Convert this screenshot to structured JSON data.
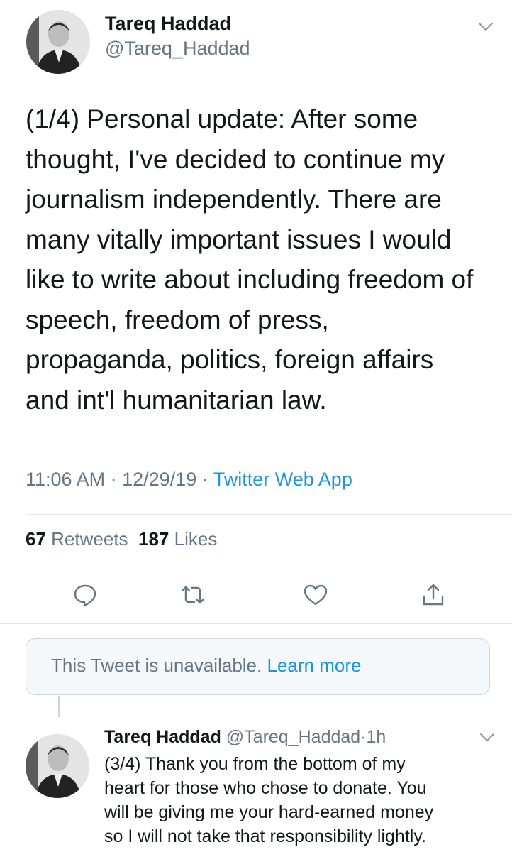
{
  "main_tweet": {
    "author_name": "Tareq Haddad",
    "author_handle": "@Tareq_Haddad",
    "text_lines": [
      "(1/4) Personal update: After some",
      "thought, I've decided to continue my",
      "journalism independently. There are",
      "many vitally important issues I would",
      "like to write about including freedom of",
      "speech, freedom of press,",
      "propaganda, politics, foreign affairs",
      "and int'l humanitarian law."
    ],
    "time": "11:06 AM",
    "date": "12/29/19",
    "separator": "·",
    "source_app": "Twitter Web App",
    "retweets_count": "67",
    "retweets_label": "Retweets",
    "likes_count": "187",
    "likes_label": "Likes"
  },
  "unavailable": {
    "message": "This Tweet is unavailable.",
    "link_text": "Learn more"
  },
  "reply_tweet": {
    "author_name": "Tareq Haddad",
    "author_handle": "@Tareq_Haddad",
    "separator": "·",
    "age": "1h",
    "text_lines": [
      "(3/4) Thank you from the bottom of my",
      "heart for those who chose to donate. You",
      "will be giving me your hard-earned money",
      "so I will not take that responsibility lightly."
    ]
  },
  "icons": {
    "reply": "reply-icon",
    "retweet": "retweet-icon",
    "like": "heart-icon",
    "share": "share-icon",
    "menu": "chevron-down-icon"
  },
  "colors": {
    "text": "#14171a",
    "secondary": "#657786",
    "link": "#1b95e0",
    "divider": "#e1e8ed"
  }
}
